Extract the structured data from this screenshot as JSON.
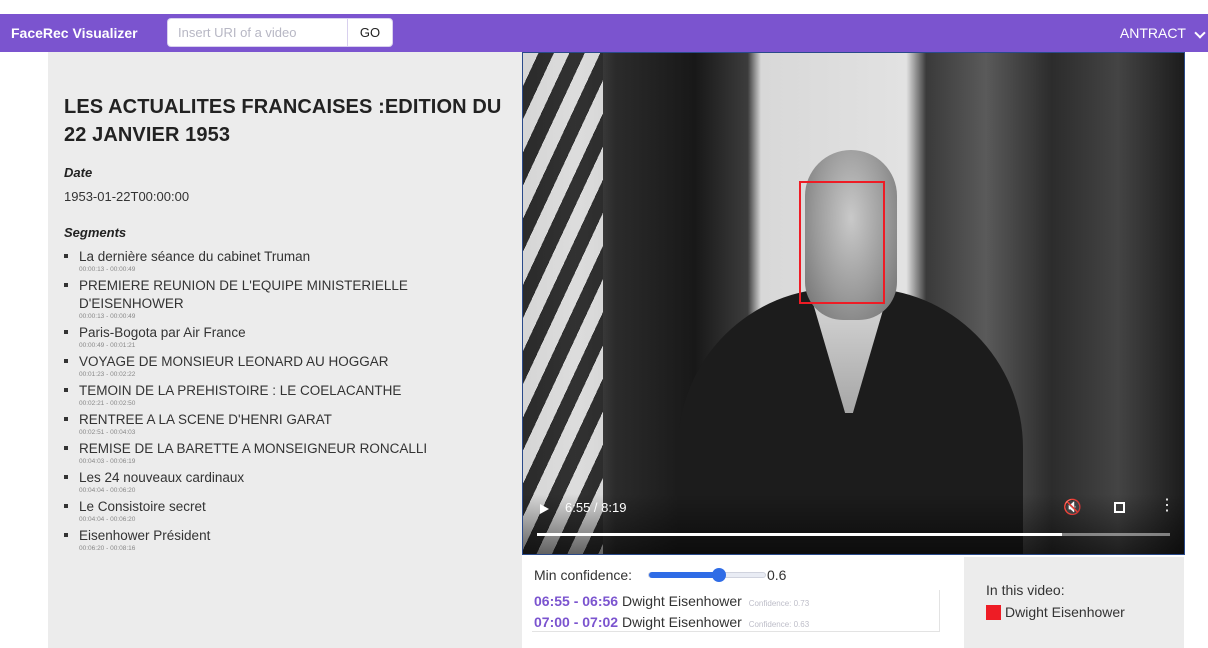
{
  "header": {
    "brand": "FaceRec Visualizer",
    "search_placeholder": "Insert URI of a video",
    "search_value": "",
    "go_label": "GO",
    "dataset": "ANTRACT"
  },
  "video_info": {
    "title": "LES ACTUALITES FRANCAISES :EDITION DU 22 JANVIER 1953",
    "date_label": "Date",
    "date_value": "1953-01-22T00:00:00",
    "segments_label": "Segments",
    "segments": [
      {
        "title": "La dernière séance du cabinet Truman",
        "time": "00:00:13 - 00:00:49"
      },
      {
        "title": "PREMIERE REUNION DE L'EQUIPE MINISTERIELLE D'EISENHOWER",
        "time": "00:00:13 - 00:00:49"
      },
      {
        "title": "Paris-Bogota par Air France",
        "time": "00:00:49 - 00:01:21"
      },
      {
        "title": "VOYAGE DE MONSIEUR LEONARD AU HOGGAR",
        "time": "00:01:23 - 00:02:22"
      },
      {
        "title": "TEMOIN DE LA PREHISTOIRE : LE COELACANTHE",
        "time": "00:02:21 - 00:02:50"
      },
      {
        "title": "RENTREE A LA SCENE D'HENRI GARAT",
        "time": "00:02:51 - 00:04:03"
      },
      {
        "title": "REMISE DE LA BARETTE A MONSEIGNEUR RONCALLI",
        "time": "00:04:03 - 00:06:19"
      },
      {
        "title": "Les 24 nouveaux cardinaux",
        "time": "00:04:04 - 00:06:20"
      },
      {
        "title": "Le Consistoire secret",
        "time": "00:04:04 - 00:06:20"
      },
      {
        "title": "Eisenhower Président",
        "time": "00:06:20 - 00:08:16"
      }
    ]
  },
  "player": {
    "time_display": "6:55 / 8:19",
    "progress_fraction": 0.83
  },
  "filter": {
    "label": "Min confidence:",
    "value": "0.6",
    "slider_fraction": 0.6
  },
  "detections": [
    {
      "range": "06:55 - 06:56",
      "name": "Dwight Eisenhower",
      "confidence": "Confidence: 0.73"
    },
    {
      "range": "07:00 - 07:02",
      "name": "Dwight Eisenhower",
      "confidence": "Confidence: 0.63"
    }
  ],
  "in_video": {
    "label": "In this video:",
    "people": [
      {
        "name": "Dwight Eisenhower",
        "color": "#ee1c25"
      }
    ]
  },
  "colors": {
    "accent": "#7b54cf",
    "face_box": "#ee1c25",
    "slider": "#2f6ce6"
  }
}
